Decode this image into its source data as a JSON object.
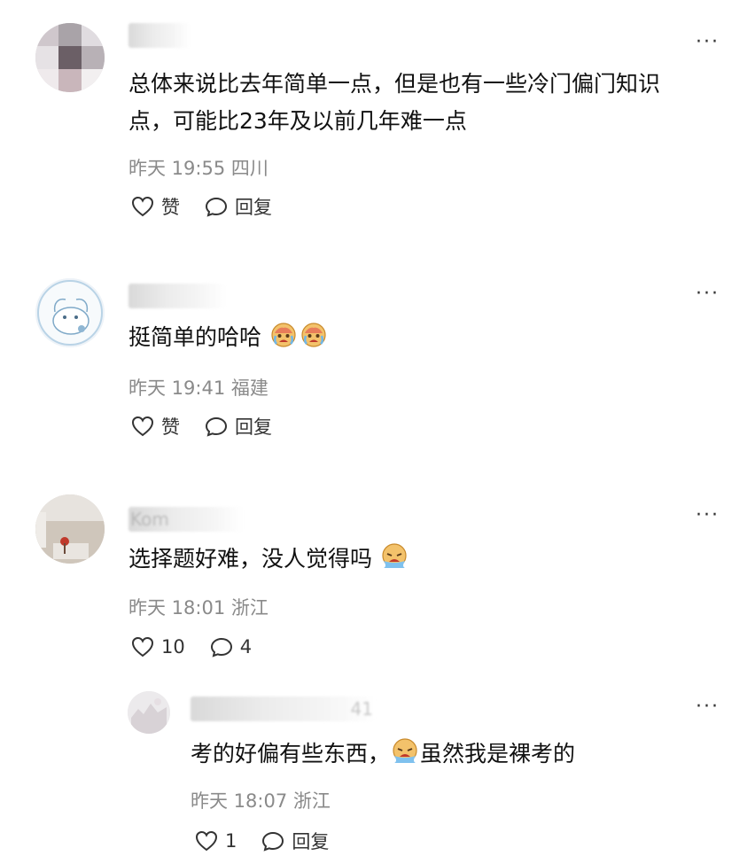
{
  "comments": [
    {
      "username": "",
      "text_lines": [
        "总体来说比去年简单一点，但是也有一些冷门偏门知识",
        "点，可能比23年及以前几年难一点"
      ],
      "time": "昨天 19:55",
      "location": "四川",
      "like_label": "赞",
      "reply_label": "回复"
    },
    {
      "username": "",
      "text": "挺简单的哈哈",
      "time": "昨天 19:41",
      "location": "福建",
      "like_label": "赞",
      "reply_label": "回复"
    },
    {
      "username": "Kom",
      "text": "选择题好难，没人觉得吗",
      "time": "昨天 18:01",
      "location": "浙江",
      "like_count": "10",
      "reply_count": "4"
    }
  ],
  "reply": {
    "username": "41",
    "text_before": "考的好偏有些东西，",
    "text_after": "虽然我是裸考的",
    "time": "昨天 18:07",
    "location": "浙江",
    "like_count": "1",
    "reply_label": "回复"
  },
  "more_symbol": "···",
  "emojis": [
    "crying-face",
    "crying-face",
    "crying-face",
    "crying-face"
  ]
}
